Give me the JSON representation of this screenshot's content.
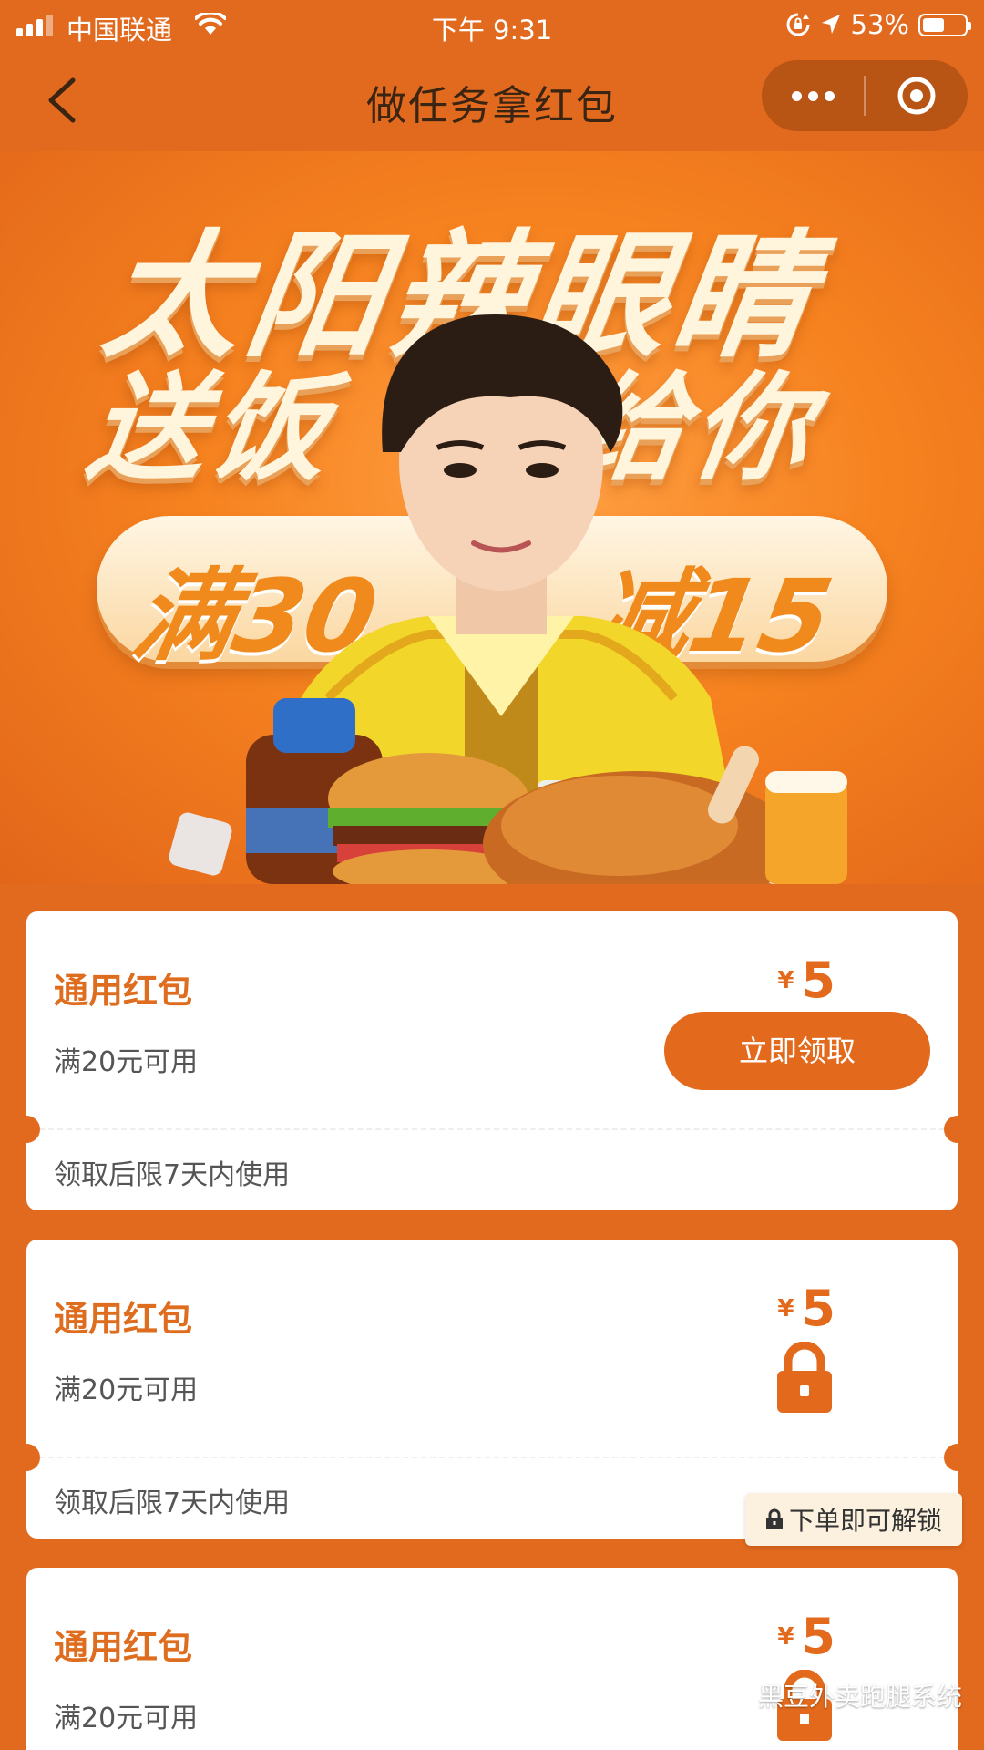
{
  "status_bar": {
    "carrier": "中国联通",
    "time": "下午 9:31",
    "battery_percent": "53%",
    "battery_level": 0.53
  },
  "nav": {
    "title": "做任务拿红包"
  },
  "banner": {
    "headline_line1": "太阳辣眼睛",
    "headline_line2_left": "送饭",
    "headline_line2_right": "给你",
    "promo_left": "满30",
    "promo_right": "减15"
  },
  "coupons": [
    {
      "title": "通用红包",
      "condition": "满20元可用",
      "currency": "¥",
      "amount": "5",
      "action_label": "立即领取",
      "validity": "领取后限7天内使用",
      "locked": false
    },
    {
      "title": "通用红包",
      "condition": "满20元可用",
      "currency": "¥",
      "amount": "5",
      "validity": "领取后限7天内使用",
      "locked": true
    },
    {
      "title": "通用红包",
      "condition": "满20元可用",
      "currency": "¥",
      "amount": "5",
      "locked": true
    }
  ],
  "unlock_tip": "下单即可解锁",
  "watermark": "黑豆外卖跑腿系统",
  "colors": {
    "page_bg": "#e26a1f",
    "accent": "#e36a1c",
    "coupon_title": "#de6d1f",
    "capsule_bg": "#b85414"
  }
}
